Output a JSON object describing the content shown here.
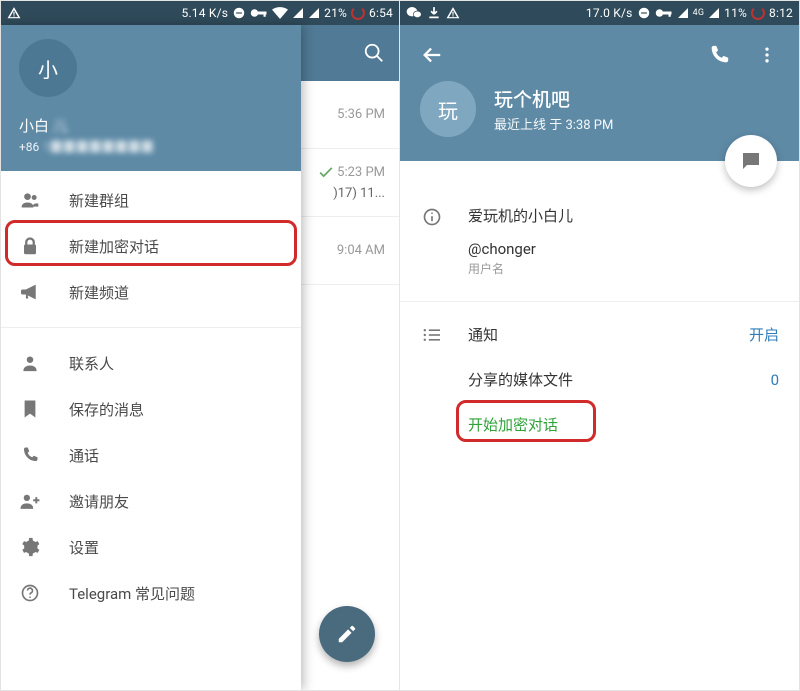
{
  "left": {
    "statusbar": {
      "speed": "5.14 K/s",
      "battery": "21%",
      "time": "6:54"
    },
    "drawer": {
      "avatar_letter": "小",
      "name_visible": "小白",
      "name_blur": "儿",
      "phone_visible": "+86",
      "phone_blur": "1▉▉▉▉▉▉▉▉",
      "items": [
        {
          "icon": "group-icon",
          "label": "新建群组"
        },
        {
          "icon": "lock-icon",
          "label": "新建加密对话"
        },
        {
          "icon": "megaphone-icon",
          "label": "新建频道"
        }
      ],
      "items2": [
        {
          "icon": "contact-icon",
          "label": "联系人"
        },
        {
          "icon": "bookmark-icon",
          "label": "保存的消息"
        },
        {
          "icon": "phone-icon",
          "label": "通话"
        },
        {
          "icon": "adduser-icon",
          "label": "邀请朋友"
        },
        {
          "icon": "gear-icon",
          "label": "设置"
        },
        {
          "icon": "help-icon",
          "label": "Telegram 常见问题"
        }
      ]
    },
    "chatlist": {
      "rows": [
        {
          "time": "5:36 PM",
          "sub": ""
        },
        {
          "time": "5:23 PM",
          "sub": ")17) 11..."
        },
        {
          "time": "9:04 AM",
          "sub": ""
        }
      ]
    }
  },
  "right": {
    "statusbar": {
      "speed": "17.0 K/s",
      "network": "4G",
      "battery": "11%",
      "time": "8:12"
    },
    "profile": {
      "avatar_letter": "玩",
      "name": "玩个机吧",
      "last_seen": "最近上线 于 3:38 PM",
      "info_title": "爱玩机的小白儿",
      "username": "@chonger",
      "username_label": "用户名",
      "rows": {
        "notify_label": "通知",
        "notify_value": "开启",
        "media_label": "分享的媒体文件",
        "media_value": "0",
        "secret_label": "开始加密对话"
      }
    }
  }
}
